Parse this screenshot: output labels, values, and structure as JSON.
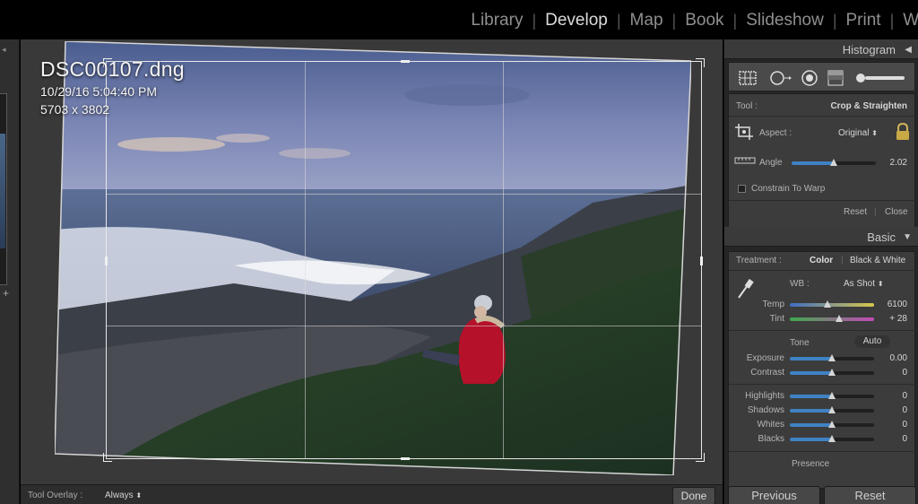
{
  "modules": {
    "library": "Library",
    "develop": "Develop",
    "map": "Map",
    "book": "Book",
    "slideshow": "Slideshow",
    "print": "Print",
    "web": "Web"
  },
  "photo_info": {
    "filename": "DSC00107.dng",
    "datetime": "10/29/16 5:04:40 PM",
    "dimensions": "5703 x 3802"
  },
  "toolbar": {
    "overlay_label": "Tool Overlay :",
    "overlay_value": "Always",
    "done_label": "Done"
  },
  "histogram": {
    "title": "Histogram"
  },
  "crop": {
    "tool_label": "Tool :",
    "tool_value": "Crop & Straighten",
    "aspect_label": "Aspect :",
    "aspect_value": "Original",
    "angle_label": "Angle",
    "angle_value": "2.02",
    "angle_level": 0.5,
    "constrain_label": "Constrain To Warp",
    "reset_label": "Reset",
    "close_label": "Close"
  },
  "basic": {
    "title": "Basic",
    "treatment_label": "Treatment :",
    "color_label": "Color",
    "bw_label": "Black & White",
    "wb_label": "WB :",
    "wb_value": "As Shot",
    "temp_label": "Temp",
    "temp_value": "6100",
    "temp_level": 0.45,
    "tint_label": "Tint",
    "tint_value": "+ 28",
    "tint_level": 0.58,
    "tone_label": "Tone",
    "auto_label": "Auto",
    "exposure_label": "Exposure",
    "exposure_value": "0.00",
    "contrast_label": "Contrast",
    "contrast_value": "0",
    "highlights_label": "Highlights",
    "highlights_value": "0",
    "shadows_label": "Shadows",
    "shadows_value": "0",
    "whites_label": "Whites",
    "whites_value": "0",
    "blacks_label": "Blacks",
    "blacks_value": "0",
    "tone_level": 0.5,
    "presence_label": "Presence"
  },
  "bottom": {
    "previous_label": "Previous",
    "reset_label": "Reset"
  },
  "colors": {
    "accent_slider": "#3f82c4",
    "panel_bg": "#3c3c3c",
    "canvas_bg": "#393939"
  }
}
